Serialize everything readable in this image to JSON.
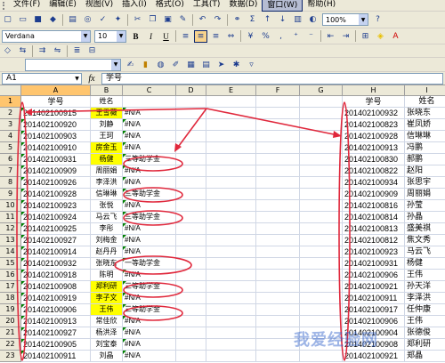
{
  "menu": {
    "items": [
      "文件(F)",
      "编辑(E)",
      "视图(V)",
      "插入(I)",
      "格式(O)",
      "工具(T)",
      "数据(D)",
      "窗口(W)",
      "帮助(H)"
    ],
    "active_index": 7
  },
  "toolbar": {
    "zoom": "100%",
    "font_name": "Verdana",
    "font_size": "10",
    "bold": "B",
    "italic": "I",
    "underline": "U"
  },
  "formula_bar": {
    "cell_ref": "A1",
    "fx": "fx",
    "content": "学号"
  },
  "columns": [
    "A",
    "B",
    "C",
    "D",
    "E",
    "F",
    "G",
    "H",
    "I"
  ],
  "selected_column": "A",
  "selected_row": 1,
  "rows": [
    {
      "num": "1",
      "a": "学号",
      "b": "姓名",
      "b_yellow": false,
      "c": "",
      "h": "学号",
      "i": "姓名"
    },
    {
      "num": "2",
      "a": "201402100915",
      "b": "王雪薇",
      "b_yellow": true,
      "c": "#N/A",
      "h": "201402100932",
      "i": "张晓东"
    },
    {
      "num": "3",
      "a": "201402100920",
      "b": "刘静",
      "b_yellow": false,
      "c": "#N/A",
      "h": "201402100823",
      "i": "崔凤娇"
    },
    {
      "num": "4",
      "a": "201402100903",
      "b": "王珂",
      "b_yellow": false,
      "c": "#N/A",
      "h": "201402100928",
      "i": "信琳琳"
    },
    {
      "num": "5",
      "a": "201402100910",
      "b": "房金玉",
      "b_yellow": true,
      "c": "#N/A",
      "h": "201402100913",
      "i": "冯鹏"
    },
    {
      "num": "6",
      "a": "201402100931",
      "b": "杨健",
      "b_yellow": true,
      "c": "三等助学金",
      "h": "201402100830",
      "i": "郝鹏"
    },
    {
      "num": "7",
      "a": "201402100909",
      "b": "周丽娟",
      "b_yellow": false,
      "c": "#N/A",
      "h": "201402100822",
      "i": "赵阳"
    },
    {
      "num": "8",
      "a": "201402100926",
      "b": "李泽洪",
      "b_yellow": false,
      "c": "#N/A",
      "h": "201402100934",
      "i": "张思宇"
    },
    {
      "num": "9",
      "a": "201402100928",
      "b": "信琳琳",
      "b_yellow": false,
      "c": "三等助学金",
      "h": "201402100909",
      "i": "周丽娟"
    },
    {
      "num": "10",
      "a": "201402100923",
      "b": "张悦",
      "b_yellow": false,
      "c": "#N/A",
      "h": "201402100816",
      "i": "孙莹"
    },
    {
      "num": "11",
      "a": "201402100924",
      "b": "马云飞",
      "b_yellow": false,
      "c": "三等助学金",
      "h": "201402100814",
      "i": "孙晶"
    },
    {
      "num": "12",
      "a": "201402100925",
      "b": "李彤",
      "b_yellow": false,
      "c": "#N/A",
      "h": "201402100813",
      "i": "盛美祺"
    },
    {
      "num": "13",
      "a": "201402100927",
      "b": "刘梅金",
      "b_yellow": false,
      "c": "#N/A",
      "h": "201402100812",
      "i": "焦文秀"
    },
    {
      "num": "14",
      "a": "201402100914",
      "b": "赵丹丹",
      "b_yellow": false,
      "c": "#N/A",
      "h": "201402100923",
      "i": "马云飞"
    },
    {
      "num": "15",
      "a": "201402100932",
      "b": "张晓东",
      "b_yellow": false,
      "c": "一等助学金",
      "h": "201402100931",
      "i": "杨健"
    },
    {
      "num": "16",
      "a": "201402100918",
      "b": "陈明",
      "b_yellow": false,
      "c": "#N/A",
      "h": "201402100906",
      "i": "王伟"
    },
    {
      "num": "17",
      "a": "201402100908",
      "b": "郑利研",
      "b_yellow": true,
      "c": "三等助学金",
      "h": "201402100921",
      "i": "孙天洋"
    },
    {
      "num": "18",
      "a": "201402100919",
      "b": "李子文",
      "b_yellow": true,
      "c": "#N/A",
      "h": "201402100911",
      "i": "李泽洪"
    },
    {
      "num": "19",
      "a": "201402100906",
      "b": "王伟",
      "b_yellow": true,
      "c": "三等助学金",
      "h": "201402100917",
      "i": "任仲康"
    },
    {
      "num": "20",
      "a": "201402100913",
      "b": "常佳欣",
      "b_yellow": false,
      "c": "#N/A",
      "h": "201402100906",
      "i": "王伟"
    },
    {
      "num": "21",
      "a": "201402100927",
      "b": "杨洪泽",
      "b_yellow": false,
      "c": "#N/A",
      "h": "201402100904",
      "i": "张德俊"
    },
    {
      "num": "22",
      "a": "201402100905",
      "b": "刘宝泰",
      "b_yellow": false,
      "c": "#N/A",
      "h": "201402100908",
      "i": "郑利研"
    },
    {
      "num": "23",
      "a": "201402100911",
      "b": "刘晶",
      "b_yellow": false,
      "c": "#N/A",
      "h": "201402100921",
      "i": "郑晶"
    }
  ],
  "watermark": "我爱经验网",
  "annotation_color": "#e0283c"
}
